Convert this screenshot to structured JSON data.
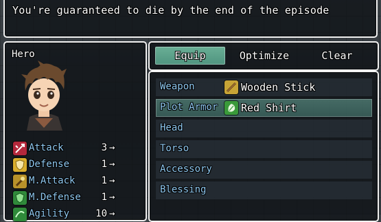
{
  "help": {
    "text": "You're guaranteed to die by the end of the episode"
  },
  "actor": {
    "name": "Hero",
    "stats": [
      {
        "label": "Attack",
        "value": "3",
        "arrow": "→",
        "icon": "attack-icon",
        "color": "#c8354a"
      },
      {
        "label": "Defense",
        "value": "1",
        "arrow": "→",
        "icon": "defense-icon",
        "color": "#e8c14a"
      },
      {
        "label": "M.Attack",
        "value": "1",
        "arrow": "→",
        "icon": "m-attack-icon",
        "color": "#c7a43a"
      },
      {
        "label": "M.Defense",
        "value": "1",
        "arrow": "→",
        "icon": "m-defense-icon",
        "color": "#3f9a3f"
      },
      {
        "label": "Agility",
        "value": "10",
        "arrow": "→",
        "icon": "agility-icon",
        "color": "#3f9a3f"
      }
    ]
  },
  "commands": [
    {
      "label": "Equip",
      "selected": true
    },
    {
      "label": "Optimize",
      "selected": false
    },
    {
      "label": "Clear",
      "selected": false
    }
  ],
  "slots": [
    {
      "label": "Weapon",
      "item": "Wooden Stick",
      "icon": "wooden-stick-icon",
      "selected": false
    },
    {
      "label": "Plot Armor",
      "item": "Red Shirt",
      "icon": "red-shirt-icon",
      "selected": true
    },
    {
      "label": "Head",
      "item": "",
      "icon": "",
      "selected": false
    },
    {
      "label": "Torso",
      "item": "",
      "icon": "",
      "selected": false
    },
    {
      "label": "Accessory",
      "item": "",
      "icon": "",
      "selected": false
    },
    {
      "label": "Blessing",
      "item": "",
      "icon": "",
      "selected": false
    }
  ],
  "colors": {
    "system_label": "#8fc8f0",
    "highlight": "#6faf9f",
    "text": "#ffffff"
  }
}
